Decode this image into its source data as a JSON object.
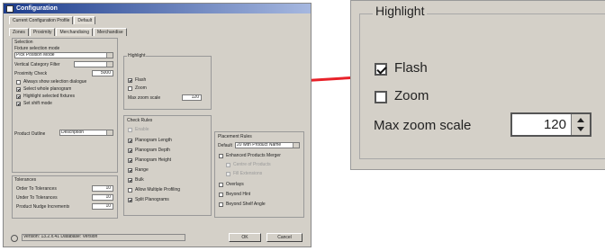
{
  "dialog": {
    "title": "Configuration",
    "profile_tabs": [
      "Current Configuration Profile",
      "Default"
    ],
    "tabs": [
      "Zones",
      "Proximity",
      "Merchandising",
      "Merchandise"
    ],
    "selection": {
      "group": "Selection",
      "fixture_label": "Fixture selection mode",
      "fixture_value": "Pick Position Mode",
      "vertical_label": "Vertical Category Filter",
      "proximity_label": "Proximity Check",
      "proximity_value": "5000",
      "checks": [
        "Always show selection dialogue",
        "Select whole planogram",
        "Highlight selected fixtures",
        "Set shift mode"
      ]
    },
    "product_outline_label": "Product Outline",
    "product_outline_value": "Description",
    "tolerances": {
      "group": "Tolerances",
      "rows": [
        {
          "label": "Order To Tolerances",
          "value": "10"
        },
        {
          "label": "Under To Tolerances",
          "value": "10"
        },
        {
          "label": "Product Nudge Increments",
          "value": "10"
        }
      ]
    },
    "highlight": {
      "group": "Highlight",
      "flash": "Flash",
      "zoom": "Zoom",
      "max_zoom_label": "Max zoom scale",
      "max_zoom_value": "120"
    },
    "check_rules": {
      "group": "Check Rules",
      "items": [
        "Enable",
        "Planogram Length",
        "Planogram Depth",
        "Planogram Height",
        "Range",
        "Bulk",
        "Allow Multiple Profiling",
        "Split Planograms"
      ]
    },
    "placement": {
      "group": "Placement Rules",
      "default_label": "Default",
      "default_value": "20 with Product Name",
      "items": [
        "Enhanced Products Merger",
        "Centre of Products",
        "Fill Extensions",
        "Overlays",
        "Beyond Hint",
        "Beyond Shelf Angle"
      ]
    },
    "status_text": "Version: 13.2.x.41 Database: Version",
    "ok": "OK",
    "cancel": "Cancel"
  },
  "zoom_panel": {
    "legend": "Highlight",
    "flash_label": "Flash",
    "flash_checked": true,
    "zoom_label": "Zoom",
    "zoom_checked": false,
    "max_zoom_label": "Max zoom scale",
    "max_zoom_value": "120"
  },
  "colors": {
    "arrow": "#e8222a",
    "dialog_bg": "#d4d0c8",
    "titlebar": "#1c3c8c"
  }
}
